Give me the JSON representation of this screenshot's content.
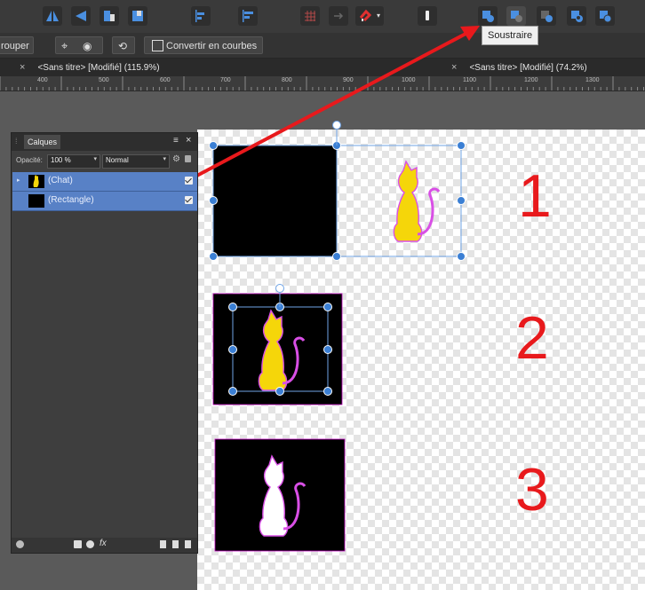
{
  "context_bar": {
    "group_label": "rouper",
    "convert_label": "Convertir en courbes"
  },
  "tooltip": {
    "text": "Soustraire"
  },
  "tabs": [
    {
      "label": "<Sans titre> [Modifié] (115.9%)"
    },
    {
      "label": "<Sans titre> [Modifié] (74.2%)"
    }
  ],
  "ruler": {
    "labels": [
      "400",
      "500",
      "600",
      "700",
      "800",
      "900",
      "1000",
      "1100",
      "1200",
      "1300"
    ]
  },
  "layers_panel": {
    "tab_label": "Calques",
    "opacity_label": "Opacité:",
    "opacity_value": "100 %",
    "blend_mode": "Normal",
    "layers": [
      {
        "name": "(Chat)",
        "visible": true,
        "selected": true
      },
      {
        "name": "(Rectangle)",
        "visible": true,
        "selected": true
      }
    ],
    "footer_fx": "fx"
  },
  "annotations": {
    "step1": "1",
    "step2": "2",
    "step3": "3"
  },
  "colors": {
    "toolbar_bg": "#3a3a3a",
    "accent_blue": "#3b7fd4",
    "layer_selection": "#5881c6",
    "annotation_red": "#e8191c",
    "cat_yellow": "#f5d60a",
    "cat_outline": "#d94fe6"
  }
}
